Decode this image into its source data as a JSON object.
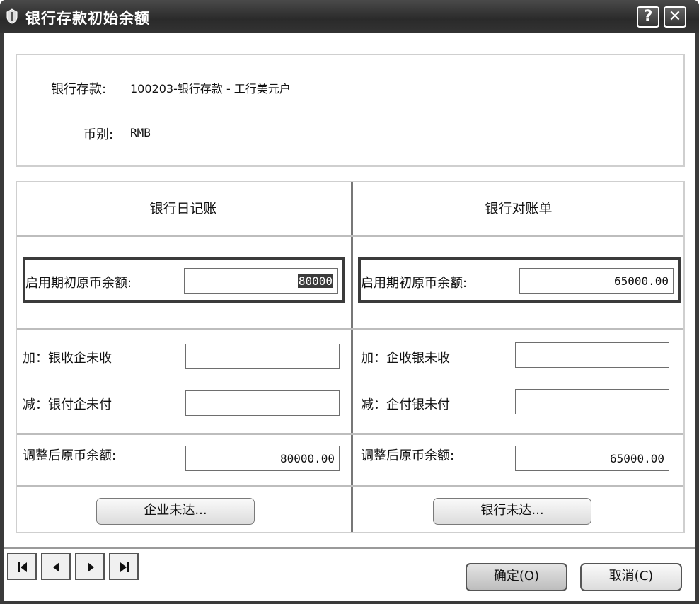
{
  "window": {
    "title": "银行存款初始余额",
    "help": "?",
    "close": "✕"
  },
  "info": {
    "account_label": "银行存款:",
    "account_value": "100203-银行存款 - 工行美元户",
    "currency_label": "币别:",
    "currency_value": "RMB"
  },
  "journal": {
    "header": "银行日记账",
    "opening_label": "启用期初原币余额:",
    "opening_value": "80000",
    "add_label": "加：银收企未收",
    "add_value": "",
    "sub_label": "减：银付企未付",
    "sub_value": "",
    "adjusted_label": "调整后原币余额:",
    "adjusted_value": "80000.00",
    "button": "企业未达..."
  },
  "statement": {
    "header": "银行对账单",
    "opening_label": "启用期初原币余额:",
    "opening_value": "65000.00",
    "add_label": "加：企收银未收",
    "add_value": "",
    "sub_label": "减：企付银未付",
    "sub_value": "",
    "adjusted_label": "调整后原币余额:",
    "adjusted_value": "65000.00",
    "button": "银行未达..."
  },
  "footer": {
    "nav_icons": [
      "first-icon",
      "prev-icon",
      "next-icon",
      "last-icon"
    ],
    "ok_button": "确定(O)",
    "cancel_button": "取消(C)"
  }
}
